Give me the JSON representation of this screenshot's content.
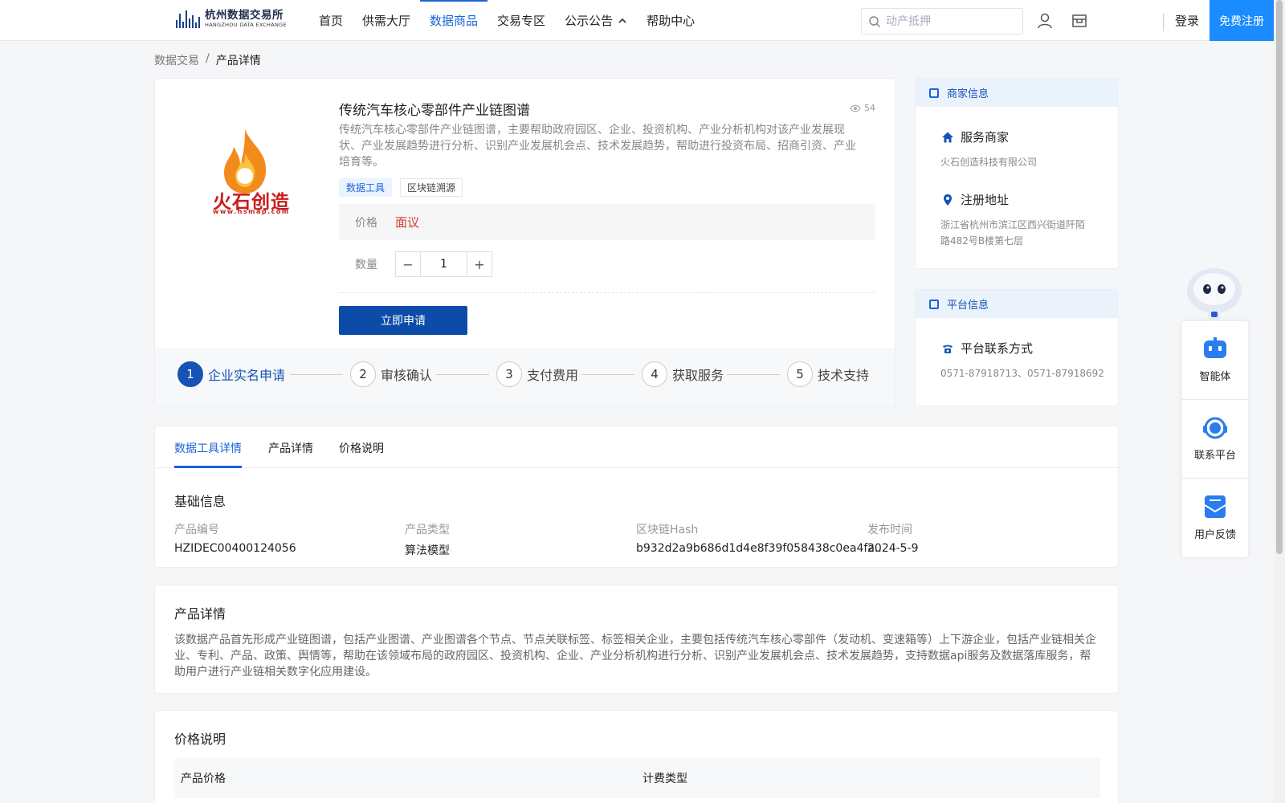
{
  "header": {
    "logo_cn": "杭州数据交易所",
    "logo_en": "HANGZHOU DATA EXCHANGE",
    "nav": [
      {
        "label": "首页",
        "active": false
      },
      {
        "label": "供需大厅",
        "active": false
      },
      {
        "label": "数据商品",
        "active": true
      },
      {
        "label": "交易专区",
        "active": false
      },
      {
        "label": "公示公告",
        "active": false,
        "caret": true
      },
      {
        "label": "帮助中心",
        "active": false
      }
    ],
    "search_placeholder": "动产抵押",
    "login": "登录",
    "register": "免费注册"
  },
  "breadcrumb": {
    "root": "数据交易",
    "sep": "/",
    "current": "产品详情"
  },
  "product": {
    "brand_name": "火石创造",
    "brand_url": "www.hsmap.com",
    "title": "传统汽车核心零部件产业链图谱",
    "views": "54",
    "description": "传统汽车核心零部件产业链图谱，主要帮助政府园区、企业、投资机构、产业分析机构对该产业发展现状、产业发展趋势进行分析、识别产业发展机会点、技术发展趋势，帮助进行投资布局、招商引资、产业培育等。",
    "tags": [
      "数据工具",
      "区块链溯源"
    ],
    "price_label": "价格",
    "price_value": "面议",
    "qty_label": "数量",
    "qty_value": "1",
    "minus": "−",
    "plus": "+",
    "apply_label": "立即申请",
    "steps": [
      {
        "num": "1",
        "label": "企业实名申请",
        "active": true
      },
      {
        "num": "2",
        "label": "审核确认",
        "active": false
      },
      {
        "num": "3",
        "label": "支付费用",
        "active": false
      },
      {
        "num": "4",
        "label": "获取服务",
        "active": false
      },
      {
        "num": "5",
        "label": "技术支持",
        "active": false
      }
    ]
  },
  "merchant": {
    "title": "商家信息",
    "service_label": "服务商家",
    "service_value": "火石创造科技有限公司",
    "address_label": "注册地址",
    "address_value": "浙江省杭州市滨江区西兴街道阡陌路482号B楼第七层"
  },
  "platform": {
    "title": "平台信息",
    "contact_label": "平台联系方式",
    "contact_value": "0571-87918713、0571-87918692"
  },
  "tabs": [
    {
      "label": "数据工具详情",
      "active": true
    },
    {
      "label": "产品详情",
      "active": false
    },
    {
      "label": "价格说明",
      "active": false
    }
  ],
  "basic_info": {
    "title": "基础信息",
    "fields": [
      {
        "key": "产品编号",
        "value": "HZIDEC00400124056"
      },
      {
        "key": "产品类型",
        "value": "算法模型"
      },
      {
        "key": "区块链Hash",
        "value": "b932d2a9b686d1d4e8f39f058438c0ea4fa..."
      },
      {
        "key": "发布时间",
        "value": "2024-5-9"
      }
    ]
  },
  "detail": {
    "title": "产品详情",
    "text": "该数据产品首先形成产业链图谱，包括产业图谱、产业图谱各个节点、节点关联标签、标签相关企业，主要包括传统汽车核心零部件（发动机、变速箱等）上下游企业，包括产业链相关企业、专利、产品、政策、舆情等，帮助在该领域布局的政府园区、投资机构、企业、产业分析机构进行分析、识别产业发展机会点、技术发展趋势，支持数据api服务及数据落库服务，帮助用户进行产业链相关数字化应用建设。"
  },
  "pricing": {
    "title": "价格说明",
    "col1": "产品价格",
    "col2": "计费类型"
  },
  "float_panel": {
    "items": [
      {
        "label": "智能体",
        "icon": "robot-icon"
      },
      {
        "label": "联系平台",
        "icon": "headset-icon"
      },
      {
        "label": "用户反馈",
        "icon": "feedback-icon"
      }
    ]
  },
  "colors": {
    "primary": "#1b63d8",
    "apply_button": "#0d4ba8",
    "price": "#d23b2e",
    "register": "#1a8cff"
  }
}
